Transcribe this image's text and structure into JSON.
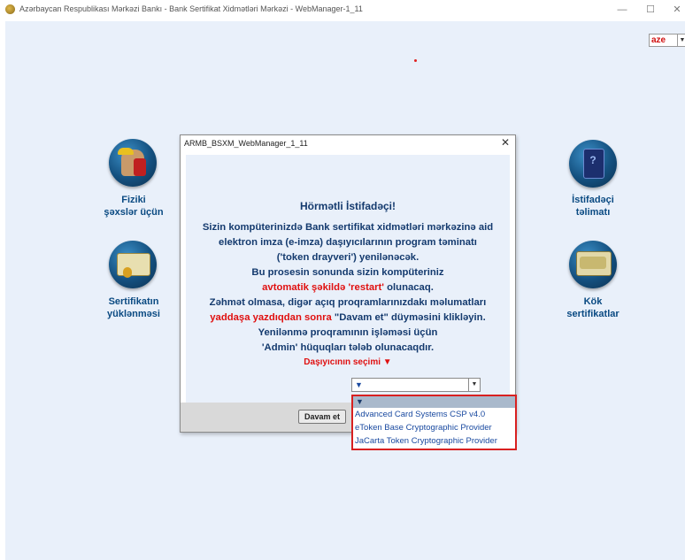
{
  "window": {
    "title": "Azərbaycan Respublikası Mərkəzi Bankı - Bank Sertifikat Xidmətləri Mərkəzi - WebManager-1_11",
    "minimize": "—",
    "maximize": "☐",
    "close": "✕"
  },
  "language": {
    "selected": "aze",
    "arrow": "▼"
  },
  "icons": {
    "individuals": {
      "line1": "Fiziki",
      "line2": "şəxslər üçün"
    },
    "certificate_load": {
      "line1": "Sertifikatın",
      "line2": "yüklənməsi"
    },
    "user_guide": {
      "line1": "İstifadəçi",
      "line2": "təlimatı"
    },
    "root_certs": {
      "line1": "Kök",
      "line2": "sertifikatlar"
    }
  },
  "dialog": {
    "title": "ARMB_BSXM_WebManager_1_11",
    "close": "✕",
    "heading": "Hörmətli İstifadəçi!",
    "lines": [
      "Sizin kompüterinizdə Bank sertifikat xidmətləri mərkəzinə aid",
      "elektron imza (e-imza) daşıyıcılarının program təminatı",
      "('token drayveri') yenilənəcək.",
      "Bu prosesin sonunda sizin kompüteriniz"
    ],
    "line5_red": "avtomatik şəkildə 'restart'",
    "line5_rest": " olunacaq.",
    "line6": "Zəhmət olmasa, digər açıq proqramlarınızdakı məlumatları",
    "line7_red": "yaddaşa yazdıqdan sonra",
    "line7_rest": " \"Davam et\" düyməsini klikləyin.",
    "line8": "Yenilənmə proqramının işləməsi üçün",
    "line9": "'Admin' hüquqları tələb olunacaqdır.",
    "selection_label": "Daşıyıcının seçimi ▼",
    "combo_value": "▼",
    "combo_arrow": "▼",
    "continue_button": "Davam et"
  },
  "dropdown": {
    "header": "▼",
    "options": [
      "Advanced Card Systems CSP v4.0",
      "eToken Base Cryptographic Provider",
      "JaCarta Token Cryptographic Provider"
    ]
  }
}
